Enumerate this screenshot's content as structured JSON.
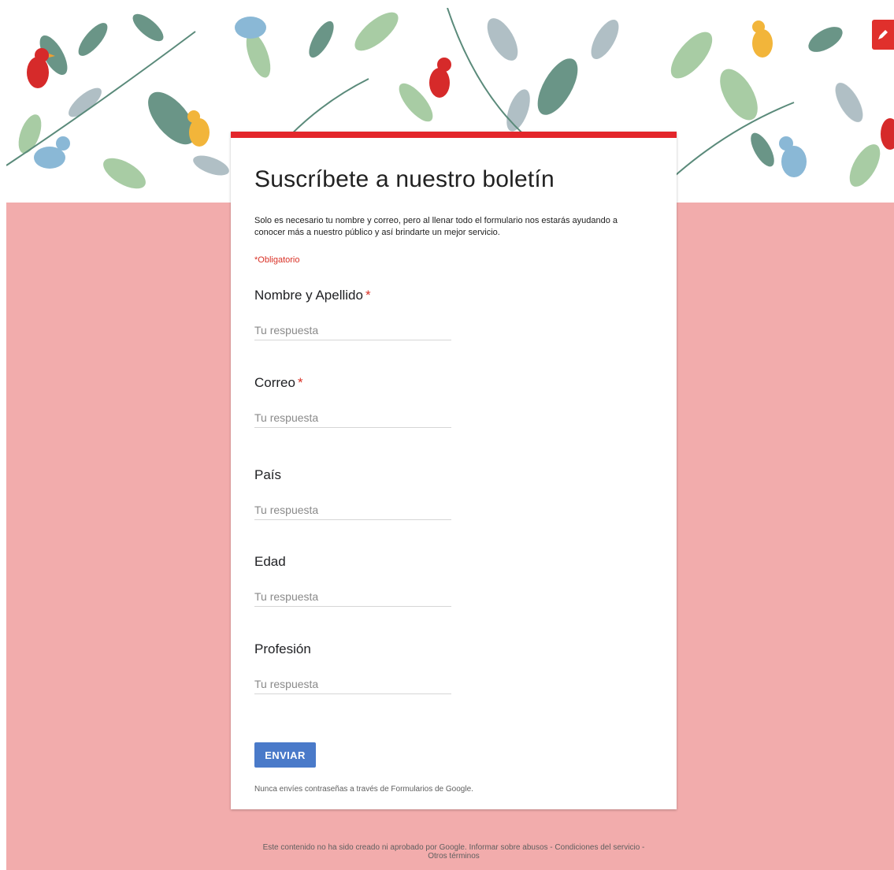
{
  "form": {
    "title": "Suscríbete a nuestro boletín",
    "description": "Solo es necesario tu nombre y correo, pero al llenar todo el formulario nos estarás ayudando a conocer más a nuestro público y así brindarte un mejor servicio.",
    "required_note": "*Obligatorio",
    "questions": [
      {
        "label": "Nombre y Apellido",
        "required_mark": "*",
        "placeholder": "Tu respuesta",
        "value": ""
      },
      {
        "label": "Correo",
        "required_mark": "*",
        "placeholder": "Tu respuesta",
        "value": ""
      },
      {
        "label": "País",
        "required_mark": "",
        "placeholder": "Tu respuesta",
        "value": ""
      },
      {
        "label": "Edad",
        "required_mark": "",
        "placeholder": "Tu respuesta",
        "value": ""
      },
      {
        "label": "Profesión",
        "required_mark": "",
        "placeholder": "Tu respuesta",
        "value": ""
      }
    ],
    "submit_label": "ENVIAR",
    "password_warning": "Nunca envíes contraseñas a través de Formularios de Google."
  },
  "footer": {
    "disclaimer": "Este contenido no ha sido creado ni aprobado por Google.",
    "report_abuse": "Informar sobre abusos",
    "terms": "Condiciones del servicio",
    "other_terms": "Otros términos"
  },
  "colors": {
    "accent": "#e3262b",
    "page_background": "#f2acac",
    "button": "#4a7ac9",
    "required": "#d93025"
  },
  "icons": {
    "banner": "floral-birds-banner",
    "corner": "edit-pencil-icon"
  }
}
